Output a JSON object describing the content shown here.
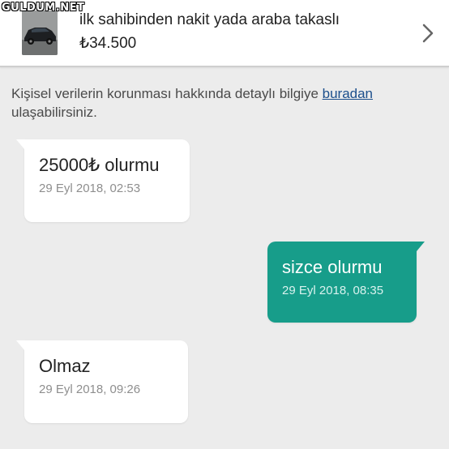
{
  "watermark": "GULDUM.NET",
  "listing": {
    "title": "ilk sahibinden nakit yada araba takaslı",
    "price": "₺34.500",
    "thumbnail_icon": "car-photo",
    "chevron_icon": "chevron-right-icon"
  },
  "privacy": {
    "text_before": "Kişisel verilerin korunması hakkında detaylı bilgiye ",
    "link": "buradan",
    "text_after": "ulaşabilirsiniz."
  },
  "messages": [
    {
      "direction": "incoming",
      "text": "25000₺ olurmu",
      "time": "29 Eyl 2018, 02:53"
    },
    {
      "direction": "outgoing",
      "text": "sizce olurmu",
      "time": "29 Eyl 2018, 08:35"
    },
    {
      "direction": "incoming",
      "text": "Olmaz",
      "time": "29 Eyl 2018, 09:26"
    }
  ],
  "colors": {
    "outgoing_bubble": "#179d8a",
    "incoming_bubble": "#ffffff",
    "background": "#ececec",
    "link": "#1c4f8c"
  }
}
